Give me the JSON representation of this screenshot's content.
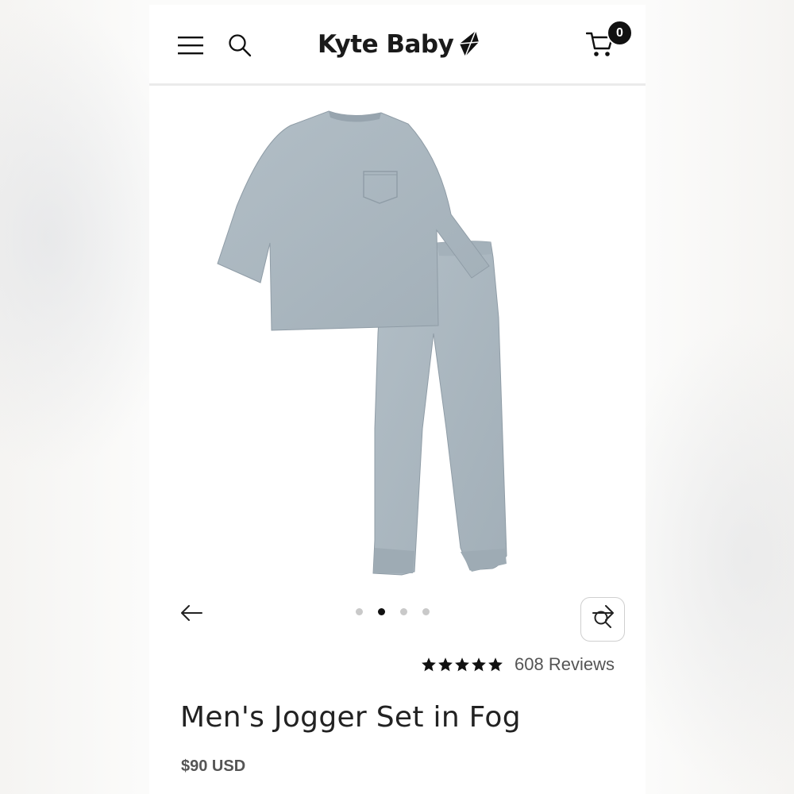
{
  "brand": {
    "name": "Kyte Baby"
  },
  "header": {
    "menu_icon": "hamburger-menu-icon",
    "search_icon": "search-icon",
    "cart_icon": "shopping-cart-icon",
    "cart_count": "0"
  },
  "gallery": {
    "image_colors": {
      "fabric": "#a9b6bf",
      "fabric_shadow": "#97a4ae"
    },
    "zoom_icon": "magnifier-icon",
    "prev_icon": "arrow-left-icon",
    "next_icon": "arrow-right-icon",
    "slide_count": 4,
    "active_slide": 2
  },
  "product": {
    "rating_stars": 5,
    "reviews_label": "608 Reviews",
    "title": "Men's Jogger Set in Fog",
    "price": "$90 USD"
  }
}
